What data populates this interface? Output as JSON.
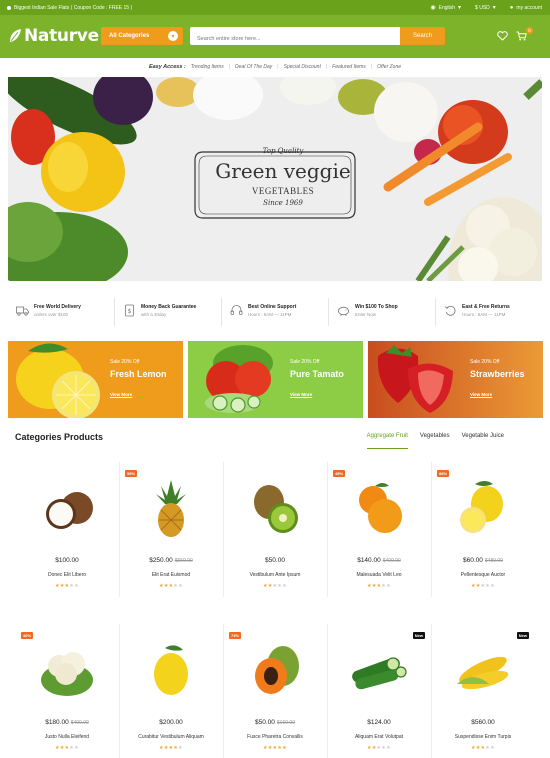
{
  "topbar": {
    "promo": "Biggest Indian Sale Flats ( Coupon Code : FREE 15 )",
    "language": "English",
    "currency": "$ USD",
    "account": "my account"
  },
  "header": {
    "logo": "Naturve",
    "category_select": "All Categories",
    "search_placeholder": "Search entire store here...",
    "search_button": "Search",
    "cart_count": "0"
  },
  "easy_access": {
    "label": "Easy Access :",
    "links": [
      "Trending Items",
      "Deal Of The Day",
      "Special Discount",
      "Featured Items",
      "Offer Zone"
    ]
  },
  "hero": {
    "top": "Top Quality",
    "main": "Green veggie",
    "sub": "VEGETABLES",
    "since": "Since 1969"
  },
  "features": [
    {
      "title": "Free World Delivery",
      "sub": "orders over $100",
      "icon": "truck-icon"
    },
    {
      "title": "Money Back Guarantee",
      "sub": "with a 30day",
      "icon": "money-icon"
    },
    {
      "title": "Best Online Support",
      "sub": "Hours : 8AM — 11PM",
      "icon": "headset-icon"
    },
    {
      "title": "Win $100 To Shop",
      "sub": "Enter Now",
      "icon": "piggy-bank-icon"
    },
    {
      "title": "East & Free Returns",
      "sub": "Hours : 8AM — 11PM",
      "icon": "return-icon"
    }
  ],
  "banners": [
    {
      "sale": "Sale 20% Off",
      "title": "Fresh Lemon",
      "link": "View More",
      "color": "#ef9b1c"
    },
    {
      "sale": "Sale 20% Off",
      "title": "Pure Tamato",
      "link": "View More",
      "color": "#8ccd45"
    },
    {
      "sale": "Sale 20% Off",
      "title": "Strawberries",
      "link": "View More",
      "color": "#e07a2d"
    }
  ],
  "categories": {
    "title": "Categories Products",
    "tabs": [
      "Aggregate Fruit",
      "Vegetables",
      "Vegetable Juice"
    ]
  },
  "products": [
    {
      "price": "$100.00",
      "old": "",
      "name": "Donec Elit Libero",
      "badge": "",
      "rating": 3,
      "image": "coconut"
    },
    {
      "price": "$250.00",
      "old": "$550.00",
      "name": "Elit Erat Euismod",
      "badge": "55%",
      "rating": 3,
      "image": "pineapple"
    },
    {
      "price": "$50.00",
      "old": "",
      "name": "Vestibulum Ante Ipsum",
      "badge": "",
      "rating": 2,
      "image": "kiwi"
    },
    {
      "price": "$140.00",
      "old": "$400.00",
      "name": "Malesuada Velit Leo",
      "badge": "45%",
      "rating": 3,
      "image": "orange"
    },
    {
      "price": "$60.00",
      "old": "$480.00",
      "name": "Pellentesque Auctor",
      "badge": "88%",
      "rating": 2,
      "image": "lemon-cut"
    },
    {
      "price": "$180.00",
      "old": "$490.00",
      "name": "Justo Nulla Eleifend",
      "badge": "40%",
      "rating": 3,
      "image": "cauliflower"
    },
    {
      "price": "$200.00",
      "old": "",
      "name": "Curabitur Vestibulum Aliquam",
      "badge": "",
      "rating": 4,
      "image": "lemon"
    },
    {
      "price": "$50.00",
      "old": "$160.00",
      "name": "Fusce Pharetra Convallis",
      "badge": "73%",
      "rating": 5,
      "image": "papaya"
    },
    {
      "price": "$124.00",
      "old": "",
      "name": "Aliquam Erat Volutpat",
      "badge": "New",
      "rating": 2,
      "image": "cucumber"
    },
    {
      "price": "$560.00",
      "old": "",
      "name": "Suspendisse Enim Turpis",
      "badge": "New",
      "rating": 3,
      "image": "corn"
    }
  ]
}
